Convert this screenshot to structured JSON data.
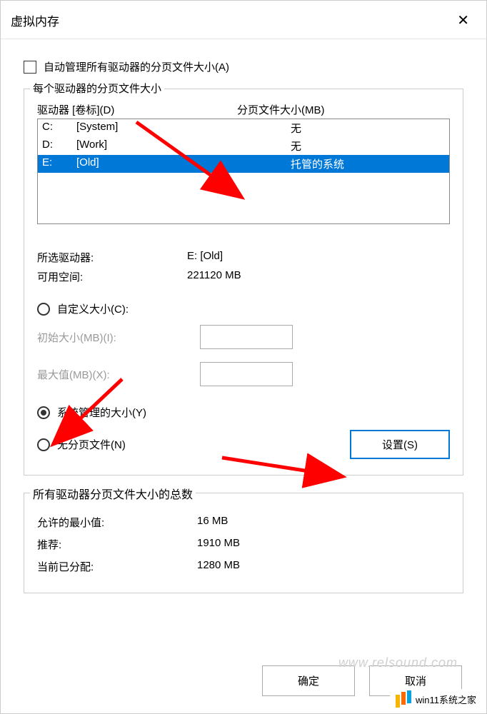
{
  "dialog": {
    "title": "虚拟内存"
  },
  "auto_manage_checkbox": {
    "label": "自动管理所有驱动器的分页文件大小(A)"
  },
  "drives_group": {
    "legend": "每个驱动器的分页文件大小",
    "header_drive": "驱动器  [卷标](D)",
    "header_size": "分页文件大小(MB)",
    "rows": [
      {
        "letter": "C:",
        "label": "[System]",
        "size": "无"
      },
      {
        "letter": "D:",
        "label": "[Work]",
        "size": "无"
      },
      {
        "letter": "E:",
        "label": "[Old]",
        "size": "托管的系统"
      }
    ],
    "selected_drive_label": "所选驱动器:",
    "selected_drive_value": "E:  [Old]",
    "free_space_label": "可用空间:",
    "free_space_value": "221120 MB",
    "radio_custom": "自定义大小(C):",
    "initial_size_label": "初始大小(MB)(I):",
    "max_size_label": "最大值(MB)(X):",
    "radio_system": "系统管理的大小(Y)",
    "radio_none": "无分页文件(N)",
    "set_button": "设置(S)"
  },
  "totals_group": {
    "legend": "所有驱动器分页文件大小的总数",
    "min_label": "允许的最小值:",
    "min_value": "16 MB",
    "rec_label": "推荐:",
    "rec_value": "1910 MB",
    "cur_label": "当前已分配:",
    "cur_value": "1280 MB"
  },
  "buttons": {
    "ok": "确定",
    "cancel": "取消"
  },
  "watermark": "www.relsound.com",
  "site_badge": "win11系统之家"
}
